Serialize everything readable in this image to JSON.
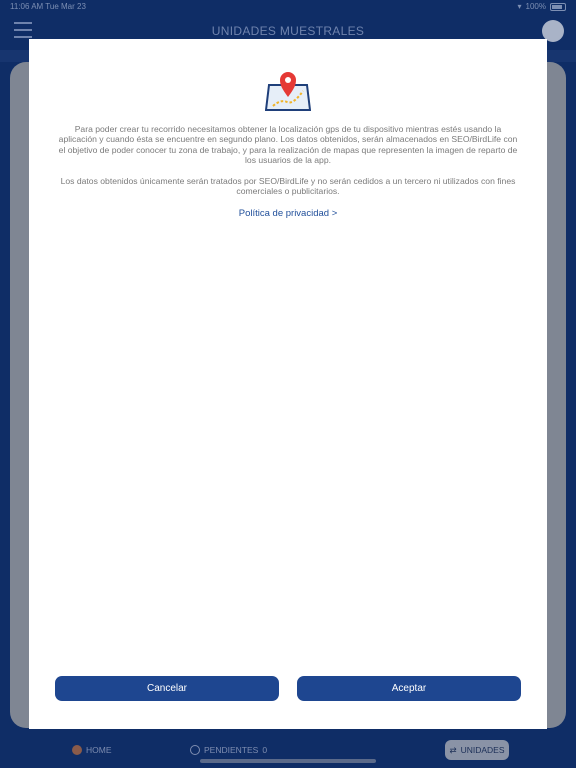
{
  "status_bar": {
    "time": "11:06 AM",
    "date": "Tue Mar 23",
    "battery": "100%"
  },
  "navbar": {
    "title": "UNIDADES MUESTRALES"
  },
  "modal": {
    "icon": "map-location-icon",
    "message_1": "Para poder crear tu recorrido necesitamos obtener la localización gps de tu dispositivo mientras estés usando la aplicación y cuando ésta se encuentre en segundo plano. Los datos obtenidos, serán almacenados en SEO/BirdLife con el objetivo de poder conocer tu zona de trabajo, y para la realización de mapas que representen la imagen de reparto de los usuarios de la app.",
    "message_2": "Los datos obtenidos únicamente serán tratados por SEO/BirdLife y no serán cedidos a un tercero ni utilizados con fines comerciales o publicitarios.",
    "privacy_link": "Política de privacidad >",
    "cancel_label": "Cancelar",
    "accept_label": "Aceptar"
  },
  "tabbar": {
    "home_label": "HOME",
    "pending_label": "PENDIENTES",
    "pending_count": "0",
    "units_label": "UNIDADES"
  },
  "colors": {
    "primary": "#1e4690",
    "background": "#0f2d66",
    "link": "#1f4e9a",
    "pin": "#e53935",
    "route": "#f0b429"
  }
}
